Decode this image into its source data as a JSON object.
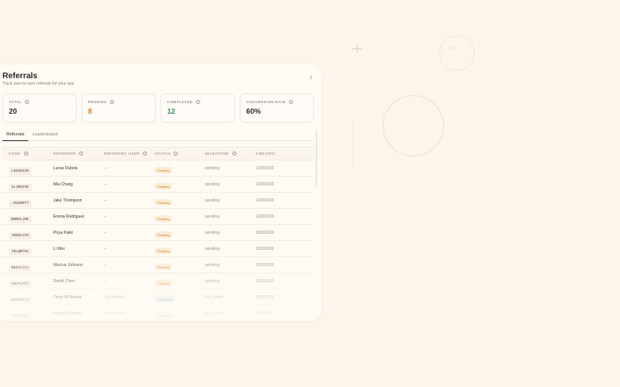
{
  "header": {
    "title": "Referrals",
    "subtitle": "Track user-to-user referrals for your app.",
    "help_label": "?"
  },
  "stats": [
    {
      "label": "TOTAL",
      "value": "20",
      "color": "#2b2724"
    },
    {
      "label": "PENDING",
      "value": "8",
      "color": "#d9822b"
    },
    {
      "label": "COMPLETED",
      "value": "12",
      "color": "#3f8a5a"
    },
    {
      "label": "CONVERSION RATE",
      "value": "60%",
      "color": "#2b2724"
    }
  ],
  "tabs": [
    {
      "label": "Referrals",
      "active": true
    },
    {
      "label": "Leaderboard",
      "active": false
    }
  ],
  "table": {
    "columns": [
      "CODE",
      "REFERRER",
      "REFERRED USER",
      "STATUS",
      "MILESTONE",
      "CREATED"
    ],
    "rows": [
      {
        "code": "L5GXKI26",
        "referrer": "Lucas Dubois",
        "referred": "–",
        "status": "Pending",
        "status_kind": "pending",
        "milestone": "pending",
        "created": "2/28/2026"
      },
      {
        "code": "ILJNVIVE",
        "referrer": "Mia Chang",
        "referred": "–",
        "status": "Pending",
        "status_kind": "pending",
        "milestone": "pending",
        "created": "2/28/2026"
      },
      {
        "code": "-ZVZKMTT",
        "referrer": "Jake Thompson",
        "referred": "–",
        "status": "Pending",
        "status_kind": "pending",
        "milestone": "pending",
        "created": "2/28/2026"
      },
      {
        "code": "BMRGLJRK",
        "referrer": "Emma Rodriguez",
        "referred": "–",
        "status": "Pending",
        "status_kind": "pending",
        "milestone": "pending",
        "created": "2/28/2026"
      },
      {
        "code": "JRSDAJYS",
        "referrer": "Priya Patel",
        "referred": "–",
        "status": "Pending",
        "status_kind": "pending",
        "milestone": "pending",
        "created": "2/28/2026"
      },
      {
        "code": "TBLQMTHA",
        "referrer": "Li Wei",
        "referred": "–",
        "status": "Pending",
        "status_kind": "pending",
        "milestone": "pending",
        "created": "2/28/2026"
      },
      {
        "code": "BBIKLIGI",
        "referrer": "Marcus Johnson",
        "referred": "–",
        "status": "Pending",
        "status_kind": "pending",
        "milestone": "pending",
        "created": "2/28/2026"
      },
      {
        "code": "XKCPLIEI",
        "referrer": "Sarah Chen",
        "referred": "–",
        "status": "Pending",
        "status_kind": "pending",
        "milestone": "pending",
        "created": "2/28/2026"
      },
      {
        "code": "WSVWIGJI",
        "referrer": "Omar Al-Rashid",
        "referred": "Zoe Adams",
        "status": "Completed",
        "status_kind": "completed",
        "milestone": "first_order",
        "created": "2/28/2026"
      },
      {
        "code": "IFDUJKHH",
        "referrer": "Hannah Fischer",
        "referred": "Noa Mueller",
        "status": "Completed",
        "status_kind": "completed",
        "milestone": "first_order",
        "created": "2/28/2026"
      }
    ]
  }
}
